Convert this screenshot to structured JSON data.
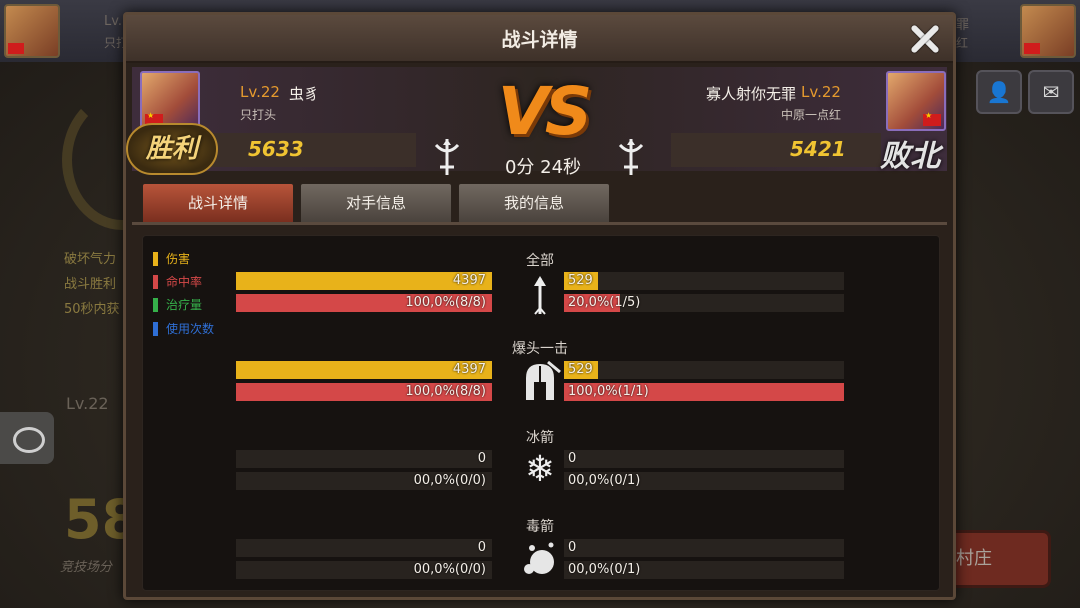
{
  "background": {
    "left_player": {
      "level_name": "Lv.",
      "title": "只打"
    },
    "right_player": {
      "name": "罪",
      "title": "红"
    },
    "stats_lines": [
      "破坏气力",
      "战斗胜利",
      "50秒内获"
    ],
    "level_text": "Lv.22",
    "big_number": "58",
    "arena_label": "竞技场分",
    "village_button": "村庄"
  },
  "dialog": {
    "title": "战斗详情",
    "close_icon": "close-icon"
  },
  "versus": {
    "left": {
      "level": "Lv.22",
      "name": "虫豸",
      "title": "只打头",
      "score": "5633",
      "result": "胜利"
    },
    "right": {
      "level": "Lv.22",
      "name": "寡人射你无罪",
      "title": "中原一点红",
      "score": "5421",
      "result": "败北"
    },
    "vs_text": "VS",
    "duration": "0分 24秒"
  },
  "tabs": [
    {
      "label": "战斗详情",
      "active": true
    },
    {
      "label": "对手信息",
      "active": false
    },
    {
      "label": "我的信息",
      "active": false
    }
  ],
  "legend": [
    {
      "label": "伤害",
      "color": "#e8b21a"
    },
    {
      "label": "命中率",
      "color": "#d44848"
    },
    {
      "label": "治疗量",
      "color": "#35b04a"
    },
    {
      "label": "使用次数",
      "color": "#2f6fd6"
    }
  ],
  "sections": [
    {
      "title": "全部",
      "icon": "arrow-icon",
      "left": {
        "damage": "4397",
        "damage_fill": 1.0,
        "hit": "100,0%(8/8)",
        "hit_fill": 1.0
      },
      "right": {
        "damage": "529",
        "damage_fill": 0.12,
        "hit": "20,0%(1/5)",
        "hit_fill": 0.2
      }
    },
    {
      "title": "爆头一击",
      "icon": "helmet-icon",
      "left": {
        "damage": "4397",
        "damage_fill": 1.0,
        "hit": "100,0%(8/8)",
        "hit_fill": 1.0
      },
      "right": {
        "damage": "529",
        "damage_fill": 0.12,
        "hit": "100,0%(1/1)",
        "hit_fill": 1.0
      }
    },
    {
      "title": "冰箭",
      "icon": "snowflake-icon",
      "left": {
        "damage": "0",
        "damage_fill": 0,
        "hit": "00,0%(0/0)",
        "hit_fill": 0
      },
      "right": {
        "damage": "0",
        "damage_fill": 0,
        "hit": "00,0%(0/1)",
        "hit_fill": 0
      }
    },
    {
      "title": "毒箭",
      "icon": "poison-icon",
      "left": {
        "damage": "0",
        "damage_fill": 0,
        "hit": "00,0%(0/0)",
        "hit_fill": 0
      },
      "right": {
        "damage": "0",
        "damage_fill": 0,
        "hit": "00,0%(0/1)",
        "hit_fill": 0
      }
    }
  ],
  "colors": {
    "damage_bar": "#e8b21a",
    "hit_bar": "#d44848",
    "accent_orange": "#f08a1a",
    "score_gold": "#f0c432"
  }
}
